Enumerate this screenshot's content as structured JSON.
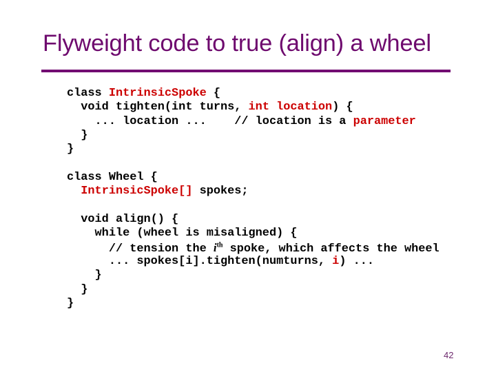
{
  "slide": {
    "title": "Flyweight code to true (align) a wheel",
    "page_number": "42",
    "colors": {
      "title": "#6e0a6e",
      "rule": "#720c72",
      "code_text": "#000000",
      "code_highlight": "#cc0000"
    }
  },
  "code": {
    "lines": [
      {
        "segments": [
          {
            "text": "class "
          },
          {
            "text": "IntrinsicSpoke",
            "hl": true
          },
          {
            "text": " {"
          }
        ]
      },
      {
        "segments": [
          {
            "text": "  void tighten(int turns, "
          },
          {
            "text": "int location",
            "hl": true
          },
          {
            "text": ") {"
          }
        ]
      },
      {
        "segments": [
          {
            "text": "    ... location ...    // location is a "
          },
          {
            "text": "parameter",
            "hl": true
          }
        ]
      },
      {
        "segments": [
          {
            "text": "  }"
          }
        ]
      },
      {
        "segments": [
          {
            "text": "}"
          }
        ]
      },
      {
        "segments": [
          {
            "text": ""
          }
        ]
      },
      {
        "segments": [
          {
            "text": "class Wheel {"
          }
        ]
      },
      {
        "segments": [
          {
            "text": "  "
          },
          {
            "text": "IntrinsicSpoke[]",
            "hl": true
          },
          {
            "text": " spokes;"
          }
        ]
      },
      {
        "segments": [
          {
            "text": ""
          }
        ]
      },
      {
        "segments": [
          {
            "text": "  void align() {"
          }
        ]
      },
      {
        "segments": [
          {
            "text": "    while (wheel is misaligned) {"
          }
        ]
      },
      {
        "segments": [
          {
            "text": "      // tension the "
          },
          {
            "text": "i",
            "ital": true
          },
          {
            "text": "th",
            "sup": true
          },
          {
            "text": " spoke, which affects the wheel"
          }
        ]
      },
      {
        "segments": [
          {
            "text": "      ... spokes[i].tighten(numturns, "
          },
          {
            "text": "i",
            "hl": true
          },
          {
            "text": ") ..."
          }
        ]
      },
      {
        "segments": [
          {
            "text": "    }"
          }
        ]
      },
      {
        "segments": [
          {
            "text": "  }"
          }
        ]
      },
      {
        "segments": [
          {
            "text": "}"
          }
        ]
      }
    ]
  }
}
